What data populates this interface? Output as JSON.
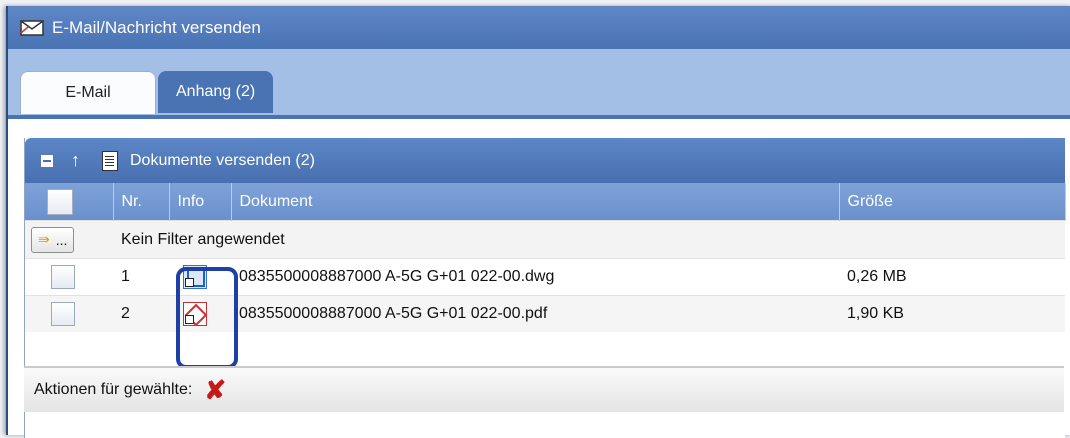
{
  "window": {
    "title": "E-Mail/Nachricht versenden",
    "icon": "mail-envelope-icon"
  },
  "tabs": [
    {
      "label": "E-Mail",
      "active": false
    },
    {
      "label": "Anhang (2)",
      "active": true
    }
  ],
  "panel": {
    "title": "Dokumente versenden (2)",
    "icons": {
      "collapse": "collapse-icon",
      "up": "arrow-up-icon",
      "doc": "document-icon"
    }
  },
  "table": {
    "columns": [
      "",
      "Nr.",
      "Info",
      "Dokument",
      "Größe"
    ],
    "filter": {
      "button_label": "...",
      "text": "Kein Filter angewendet"
    },
    "rows": [
      {
        "nr": "1",
        "info": "dwg-file-icon",
        "dokument": "0835500008887000 A-5G G+01 022-00.dwg",
        "groesse": "0,26 MB"
      },
      {
        "nr": "2",
        "info": "pdf-file-icon",
        "dokument": "0835500008887000 A-5G G+01 022-00.pdf",
        "groesse": "1,90 KB"
      }
    ]
  },
  "actions": {
    "label": "Aktionen für gewählte:",
    "delete_icon": "delete-x-icon"
  },
  "colors": {
    "header_blue": "#4a73b4",
    "tab_bar": "#a4bfe5",
    "highlight": "#1d3fa6",
    "delete": "#c41a1a"
  }
}
